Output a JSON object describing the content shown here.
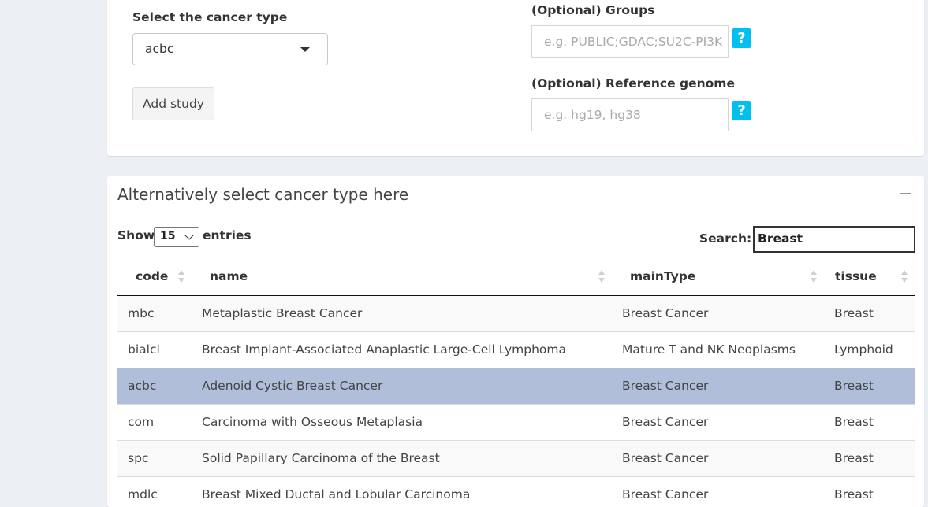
{
  "form": {
    "cancer_type_label": "Select the cancer type",
    "cancer_type_value": "acbc",
    "add_study_label": "Add study",
    "groups_label": "(Optional) Groups",
    "groups_placeholder": "e.g. PUBLIC;GDAC;SU2C-PI3K",
    "genome_label": "(Optional) Reference genome",
    "genome_placeholder": "e.g. hg19, hg38",
    "help_glyph": "?"
  },
  "table_box": {
    "title": "Alternatively select cancer type here",
    "show_label": "Show",
    "entries_label": "entries",
    "length_value": "15",
    "search_label": "Search:",
    "search_value": "Breast",
    "columns": [
      "code",
      "name",
      "mainType",
      "tissue"
    ],
    "rows": [
      {
        "code": "mbc",
        "name": "Metaplastic Breast Cancer",
        "mainType": "Breast Cancer",
        "tissue": "Breast"
      },
      {
        "code": "bialcl",
        "name": "Breast Implant-Associated Anaplastic Large-Cell Lymphoma",
        "mainType": "Mature T and NK Neoplasms",
        "tissue": "Lymphoid"
      },
      {
        "code": "acbc",
        "name": "Adenoid Cystic Breast Cancer",
        "mainType": "Breast Cancer",
        "tissue": "Breast",
        "selected": true
      },
      {
        "code": "com",
        "name": "Carcinoma with Osseous Metaplasia",
        "mainType": "Breast Cancer",
        "tissue": "Breast"
      },
      {
        "code": "spc",
        "name": "Solid Papillary Carcinoma of the Breast",
        "mainType": "Breast Cancer",
        "tissue": "Breast"
      },
      {
        "code": "mdlc",
        "name": "Breast Mixed Ductal and Lobular Carcinoma",
        "mainType": "Breast Cancer",
        "tissue": "Breast"
      }
    ]
  },
  "colors": {
    "page_bg": "#ecf0f5",
    "help_button": "#00c0ef",
    "selected_row": "#b0bed9"
  }
}
